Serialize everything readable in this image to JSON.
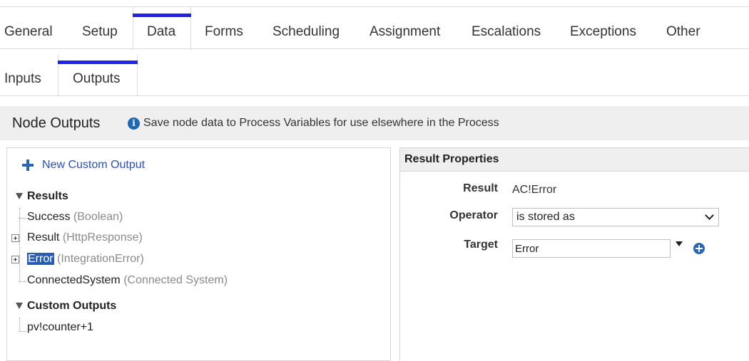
{
  "tabs": [
    "General",
    "Setup",
    "Data",
    "Forms",
    "Scheduling",
    "Assignment",
    "Escalations",
    "Exceptions",
    "Other"
  ],
  "active_tab": "Data",
  "subtabs": [
    "Inputs",
    "Outputs"
  ],
  "active_subtab": "Outputs",
  "node_outputs": {
    "title": "Node Outputs",
    "info": "Save node data to Process Variables for use elsewhere in the Process"
  },
  "tree": {
    "new_custom_output": "New Custom Output",
    "results_label": "Results",
    "results": [
      {
        "name": "Success",
        "type": "(Boolean)",
        "expandable": false,
        "selected": false
      },
      {
        "name": "Result",
        "type": "(HttpResponse)",
        "expandable": true,
        "selected": false
      },
      {
        "name": "Error",
        "type": "(IntegrationError)",
        "expandable": true,
        "selected": true
      },
      {
        "name": "ConnectedSystem",
        "type": "(Connected System)",
        "expandable": false,
        "selected": false
      }
    ],
    "custom_outputs_label": "Custom Outputs",
    "custom_outputs": [
      {
        "name": "pv!counter+1"
      }
    ]
  },
  "result_properties": {
    "title": "Result Properties",
    "result_label": "Result",
    "result_value": "AC!Error",
    "operator_label": "Operator",
    "operator_value": "is stored as",
    "target_label": "Target",
    "target_value": "Error"
  },
  "colors": {
    "active_tab_bar": "#2323e6",
    "link": "#2a4fc0",
    "selection": "#2a5db0",
    "header_bg": "#efefef"
  }
}
